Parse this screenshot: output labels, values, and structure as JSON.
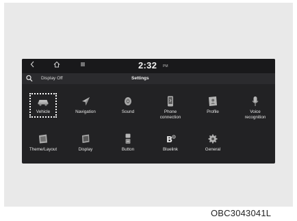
{
  "status_bar": {
    "back_icon": "chevron-left-icon",
    "home_icon": "home-icon",
    "menu_icon": "menu-icon",
    "time": "2:32",
    "period": "PM"
  },
  "sub_bar": {
    "search_icon": "search-icon",
    "display_off_label": "Display Off",
    "title": "Settings"
  },
  "grid": {
    "selected_item": "Vehicle",
    "items": [
      {
        "label": "Vehicle",
        "icon": "car-icon"
      },
      {
        "label": "Navigation",
        "icon": "navigation-arrow-icon"
      },
      {
        "label": "Sound",
        "icon": "speaker-icon"
      },
      {
        "label": "Phone\nconnection",
        "icon": "phone-icon"
      },
      {
        "label": "Profile",
        "icon": "profile-icon"
      },
      {
        "label": "Voice\nrecognition",
        "icon": "microphone-icon"
      },
      {
        "label": "Theme/Layout",
        "icon": "theme-icon"
      },
      {
        "label": "Display",
        "icon": "display-icon"
      },
      {
        "label": "Button",
        "icon": "button-icon"
      },
      {
        "label": "Bluelink",
        "icon": "bluelink-icon"
      },
      {
        "label": "General",
        "icon": "gear-icon"
      }
    ]
  },
  "caption": "OBC3043041L"
}
